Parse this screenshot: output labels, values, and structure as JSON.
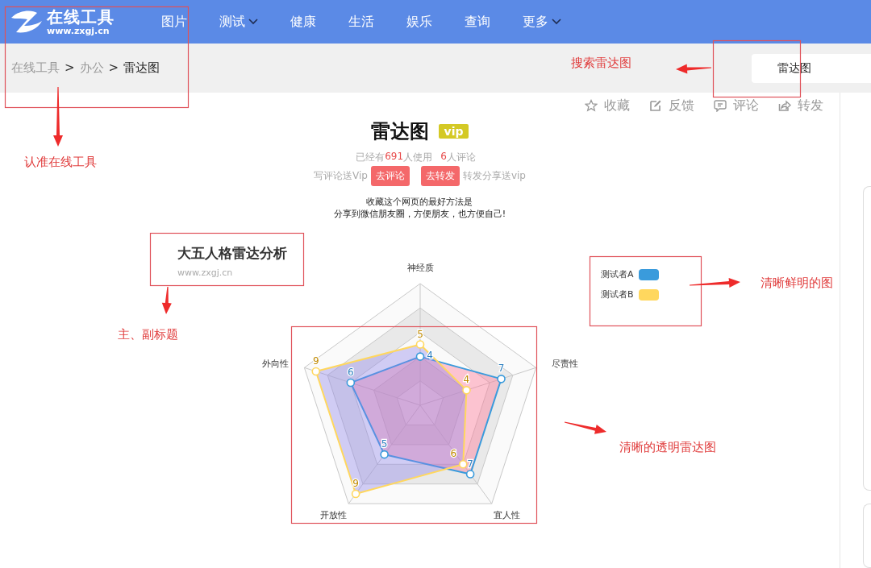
{
  "nav": {
    "logo": {
      "title": "在线工具",
      "url": "www.zxgj.cn"
    },
    "items": [
      {
        "label": "图片",
        "dropdown": false
      },
      {
        "label": "测试",
        "dropdown": true
      },
      {
        "label": "健康",
        "dropdown": false
      },
      {
        "label": "生活",
        "dropdown": false
      },
      {
        "label": "娱乐",
        "dropdown": false
      },
      {
        "label": "查询",
        "dropdown": false
      },
      {
        "label": "更多",
        "dropdown": true
      }
    ]
  },
  "breadcrumb": {
    "separator": ">",
    "items": [
      {
        "label": "在线工具",
        "current": false
      },
      {
        "label": "办公",
        "current": false
      },
      {
        "label": "雷达图",
        "current": true
      }
    ]
  },
  "search": {
    "value": "雷达图"
  },
  "actions": [
    {
      "label": "收藏",
      "kind": "star"
    },
    {
      "label": "反馈",
      "kind": "edit"
    },
    {
      "label": "评论",
      "kind": "comment"
    },
    {
      "label": "转发",
      "kind": "share"
    }
  ],
  "tool": {
    "title": "雷达图",
    "badge": "vip",
    "stats": [
      {
        "text": "已经有",
        "highlight": false
      },
      {
        "text": "691",
        "highlight": true
      },
      {
        "text": "人使用",
        "highlight": false
      },
      {
        "text": "6",
        "highlight": true
      },
      {
        "text": "人评论",
        "highlight": false
      }
    ],
    "promo_left": "写评论送Vip",
    "buttons": [
      "去评论",
      "去转发"
    ],
    "promo_right": "转发分享送vip",
    "message": [
      "收藏这个网页的最好方法是",
      "分享到微信朋友圈，方便朋友，也方便自己!"
    ]
  },
  "chart": {
    "title": "大五人格雷达分析",
    "subtitle": "www.zxgj.cn",
    "radar": {
      "axes": [
        "神经质",
        "尽责性",
        "宜人性",
        "开放性",
        "外向性"
      ],
      "series": [
        {
          "name": "测试者A",
          "color": "#3a9bdc",
          "values": [
            "4",
            "7",
            "7",
            "5",
            "6"
          ]
        },
        {
          "name": "测试者B",
          "color": "#ffd75e",
          "values": [
            "5",
            "4",
            "6",
            "9",
            "9"
          ]
        }
      ]
    }
  },
  "annotations": [
    {
      "text": "认准在线工具"
    },
    {
      "text": "搜索雷达图"
    },
    {
      "text": "主、副标题"
    },
    {
      "text": "清晰鲜明的图"
    },
    {
      "text": "清晰的透明雷达图"
    }
  ],
  "annotation_marks": [
    {
      "kind": "box"
    },
    {
      "kind": "box"
    },
    {
      "kind": "box"
    },
    {
      "kind": "box"
    },
    {
      "kind": "box"
    },
    {
      "kind": "arrow"
    },
    {
      "kind": "arrow"
    },
    {
      "kind": "arrow"
    },
    {
      "kind": "arrow"
    },
    {
      "kind": "arrow"
    }
  ]
}
